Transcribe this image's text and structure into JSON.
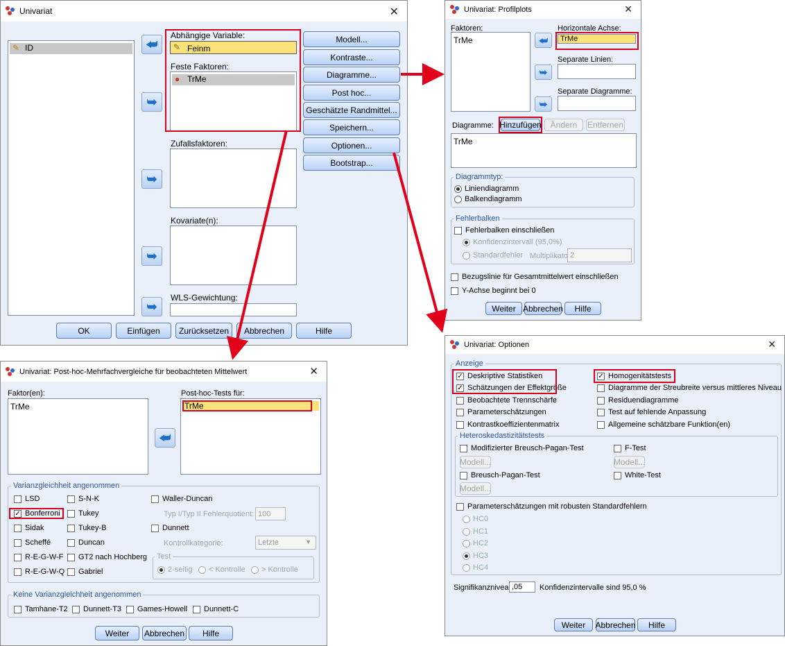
{
  "univariat": {
    "title": "Univariat",
    "variable": "ID",
    "dependent_label": "Abhängige Variable:",
    "dependent_value": "Feinm",
    "fixed_label": "Feste Faktoren:",
    "fixed_value": "TrMe",
    "random_label": "Zufallsfaktoren:",
    "covariate_label": "Kovariate(n):",
    "wls_label": "WLS-Gewichtung:",
    "buttons": [
      "Modell...",
      "Kontraste...",
      "Diagramme...",
      "Post hoc...",
      "Geschätzte Randmittel...",
      "Speichern...",
      "Optionen...",
      "Bootstrap..."
    ],
    "bottom": [
      "OK",
      "Einfügen",
      "Zurücksetzen",
      "Abbrechen",
      "Hilfe"
    ]
  },
  "profil": {
    "title": "Univariat: Profilplots",
    "factors_label": "Faktoren:",
    "factors": [
      "TrMe"
    ],
    "horizontal_label": "Horizontale Achse:",
    "horizontal_value": "TrMe",
    "separate_lines_label": "Separate Linien:",
    "separate_diagrams_label": "Separate Diagramme:",
    "diagrams_label": "Diagramme:",
    "add": "Hinzufügen",
    "change": "Ändern",
    "remove": "Entfernen",
    "diagrams": [
      "TrMe"
    ],
    "charttype_group": "Diagrammtyp:",
    "line": "Liniendiagramm",
    "bar": "Balkendiagramm",
    "errorbars_group": "Fehlerbalken",
    "include_errorbars": "Fehlerbalken einschließen",
    "ci": "Konfidenzintervall (95,0%)",
    "se": "Standardfehler",
    "multiplier_label": "Multiplikator:",
    "multiplier_value": "2",
    "refline": "Bezugslinie für Gesamtmittelwert einschließen",
    "yzero": "Y-Achse beginnt bei 0",
    "buttons": [
      "Weiter",
      "Abbrechen",
      "Hilfe"
    ]
  },
  "posthoc": {
    "title": "Univariat: Post-hoc-Mehrfachvergleiche für beobachteten Mittelwert",
    "factors_label": "Faktor(en):",
    "factors": [
      "TrMe"
    ],
    "tests_for_label": "Post-hoc-Tests für:",
    "tests_for": [
      "TrMe"
    ],
    "equal_group": "Varianzgleichheit angenommen",
    "col1": [
      "LSD",
      "Bonferroni",
      "Sidak",
      "Scheffé",
      "R-E-G-W-F",
      "R-E-G-W-Q"
    ],
    "col2": [
      "S-N-K",
      "Tukey",
      "Tukey-B",
      "Duncan",
      "GT2 nach Hochberg",
      "Gabriel"
    ],
    "waller": "Waller-Duncan",
    "ratio_label": "Typ I/Typ II Fehlerquotient:",
    "ratio_value": "100",
    "dunnett": "Dunnett",
    "control_label": "Kontrollkategorie:",
    "control_value": "Letzte",
    "test_group": "Test",
    "twosided": "2-seitig",
    "lt": "< Kontrolle",
    "gt": "> Kontrolle",
    "unequal_group": "Keine Varianzgleichheit angenommen",
    "unequal": [
      "Tamhane-T2",
      "Dunnett-T3",
      "Games-Howell",
      "Dunnett-C"
    ],
    "buttons": [
      "Weiter",
      "Abbrechen",
      "Hilfe"
    ]
  },
  "optionen": {
    "title": "Univariat: Optionen",
    "display_group": "Anzeige",
    "left": [
      "Deskriptive Statistiken",
      "Schätzungen der Effektgröße",
      "Beobachtete Trennschärfe",
      "Parameterschätzungen",
      "Kontrastkoeffizientenmatrix"
    ],
    "right": [
      "Homogenitätstests",
      "Diagramme der Streubreite versus mittleres Niveau",
      "Residuendiagramme",
      "Test auf fehlende Anpassung",
      "Allgemeine schätzbare Funktion(en)"
    ],
    "hetero_group": "Heteroskedastizitätstests",
    "bp_mod": "Modifizierter Breusch-Pagan-Test",
    "ftest": "F-Test",
    "model_btn": "Modell...",
    "bp": "Breusch-Pagan-Test",
    "white": "White-Test",
    "robust": "Parameterschätzungen mit robusten Standardfehlern",
    "hc": [
      "HC0",
      "HC1",
      "HC2",
      "HC3",
      "HC4"
    ],
    "sig_label": "Signifikanzniveau:",
    "sig_value": ",05",
    "ci_text": "Konfidenzintervalle sind 95,0 %",
    "buttons": [
      "Weiter",
      "Abbrechen",
      "Hilfe"
    ]
  }
}
